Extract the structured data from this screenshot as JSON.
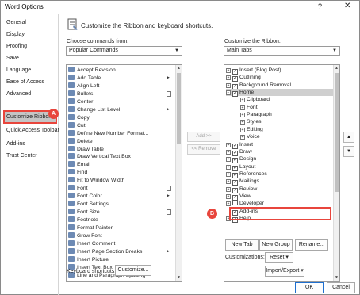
{
  "window": {
    "title": "Word Options",
    "help": "?",
    "close": "✕"
  },
  "sidebar": {
    "items": [
      {
        "label": "General"
      },
      {
        "label": "Display"
      },
      {
        "label": "Proofing"
      },
      {
        "label": "Save"
      },
      {
        "label": "Language"
      },
      {
        "label": "Ease of Access"
      },
      {
        "label": "Advanced"
      },
      {
        "label": "Customize Ribbon"
      },
      {
        "label": "Quick Access Toolbar"
      },
      {
        "label": "Add-ins"
      },
      {
        "label": "Trust Center"
      }
    ],
    "selected_badge": "A"
  },
  "main": {
    "heading": "Customize the Ribbon and keyboard shortcuts.",
    "choose_label": "Choose commands from:",
    "choose_value": "Popular Commands",
    "customize_label": "Customize the Ribbon:",
    "customize_value": "Main Tabs"
  },
  "commands": [
    "Accept Revision",
    "Add Table",
    "Align Left",
    "Bullets",
    "Center",
    "Change List Level",
    "Copy",
    "Cut",
    "Define New Number Format...",
    "Delete",
    "Draw Table",
    "Draw Vertical Text Box",
    "Email",
    "Find",
    "Fit to Window Width",
    "Font",
    "Font Color",
    "Font Settings",
    "Font Size",
    "Footnote",
    "Format Painter",
    "Grow Font",
    "Insert Comment",
    "Insert Page  Section Breaks",
    "Insert Picture",
    "Insert Text Box",
    "Line and Paragraph Spacing"
  ],
  "ribbon_tree": [
    {
      "label": "Insert (Blog Post)",
      "level": 0,
      "expander": "+",
      "check": "✓"
    },
    {
      "label": "Outlining",
      "level": 0,
      "expander": "+",
      "check": "✓"
    },
    {
      "label": "Background Removal",
      "level": 0,
      "expander": "+",
      "check": "✓"
    },
    {
      "label": "Home",
      "level": 0,
      "expander": "−",
      "check": "✓"
    },
    {
      "label": "Clipboard",
      "level": 1,
      "expander": "+",
      "check": ""
    },
    {
      "label": "Font",
      "level": 1,
      "expander": "+",
      "check": ""
    },
    {
      "label": "Paragraph",
      "level": 1,
      "expander": "+",
      "check": ""
    },
    {
      "label": "Styles",
      "level": 1,
      "expander": "+",
      "check": ""
    },
    {
      "label": "Editing",
      "level": 1,
      "expander": "+",
      "check": ""
    },
    {
      "label": "Voice",
      "level": 1,
      "expander": "+",
      "check": ""
    },
    {
      "label": "Insert",
      "level": 0,
      "expander": "+",
      "check": "✓"
    },
    {
      "label": "Draw",
      "level": 0,
      "expander": "+",
      "check": "✓"
    },
    {
      "label": "Design",
      "level": 0,
      "expander": "+",
      "check": "✓"
    },
    {
      "label": "Layout",
      "level": 0,
      "expander": "+",
      "check": "✓"
    },
    {
      "label": "References",
      "level": 0,
      "expander": "+",
      "check": "✓"
    },
    {
      "label": "Mailings",
      "level": 0,
      "expander": "+",
      "check": "✓"
    },
    {
      "label": "Review",
      "level": 0,
      "expander": "+",
      "check": "✓"
    },
    {
      "label": "View",
      "level": 0,
      "expander": "+",
      "check": "✓"
    },
    {
      "label": "Developer",
      "level": 0,
      "expander": "+",
      "check": ""
    },
    {
      "label": "Add-ins",
      "level": 0,
      "expander": "",
      "check": "✓"
    },
    {
      "label": "Help",
      "level": 0,
      "expander": "+",
      "check": "✓"
    }
  ],
  "buttons": {
    "add": "Add >>",
    "remove": "<< Remove",
    "move_up": "▲",
    "move_down": "▼",
    "new_tab": "New Tab",
    "new_group": "New Group",
    "rename": "Rename...",
    "customizations_label": "Customizations:",
    "reset": "Reset ▾",
    "import_export": "Import/Export ▾",
    "keyboard_label": "Keyboard shortcuts:",
    "customize": "Customize...",
    "ok": "OK",
    "cancel": "Cancel"
  },
  "developer_badge": "B",
  "colors": {
    "accent_red": "#e8453c",
    "selection": "#c5c5c5",
    "primary_border": "#1e6fcf"
  }
}
